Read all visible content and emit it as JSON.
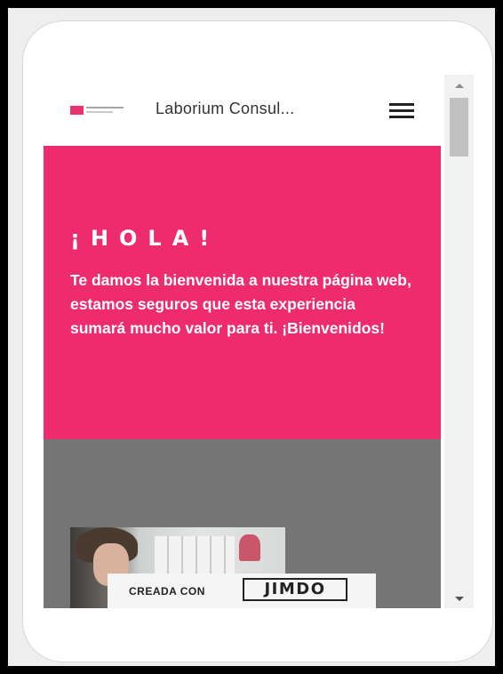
{
  "header": {
    "logo_icon": "laborium-logo",
    "site_title": "Laborium Consul...",
    "menu_icon": "hamburger-icon"
  },
  "hero": {
    "title": "¡HOLA!",
    "text": "Te damos la bienvenida a nuestra página web, estamos seguros que esta experiencia sumará mucho valor para ti. ¡Bienvenidos!",
    "background_color": "#ee2b6d"
  },
  "gray_section": {
    "background_color": "#757575",
    "image": "woman-in-office-photo"
  },
  "jimdo_badge": {
    "label": "CREADA CON",
    "brand": "JIMDO"
  },
  "colors": {
    "accent": "#ee2b6d",
    "section_gray": "#757575",
    "frame": "#eeeeee"
  }
}
